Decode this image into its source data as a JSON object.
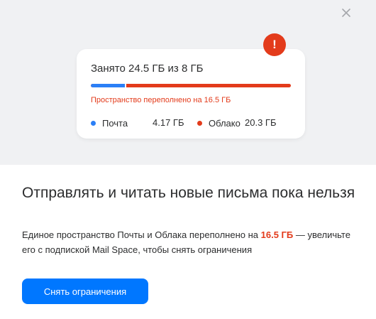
{
  "storage": {
    "title": "Занято 24.5 ГБ из 8 ГБ",
    "overflow_text": "Пространство переполнено на 16.5 ГБ",
    "mail_used_fraction": 0.17,
    "legend": [
      {
        "label": "Почта",
        "value": "4.17 ГБ",
        "color": "#2b7ff6"
      },
      {
        "label": "Облако",
        "value": "20.3 ГБ",
        "color": "#e33b1b"
      }
    ],
    "warning_badge": "!"
  },
  "message": {
    "headline": "Отправлять и читать новые письма пока нельзя",
    "desc_before": "Единое пространство Почты и Облака переполнено на ",
    "desc_accent": "16.5 ГБ",
    "desc_after": " — увеличьте его с подпиской Mail Space, чтобы снять ограничения"
  },
  "actions": {
    "remove_limits": "Снять ограничения"
  },
  "colors": {
    "accent_red": "#e33b1b",
    "primary_blue": "#0077ff",
    "mail_blue": "#2b7ff6"
  },
  "icons": {
    "close": "close-icon",
    "warning": "exclamation-icon"
  }
}
